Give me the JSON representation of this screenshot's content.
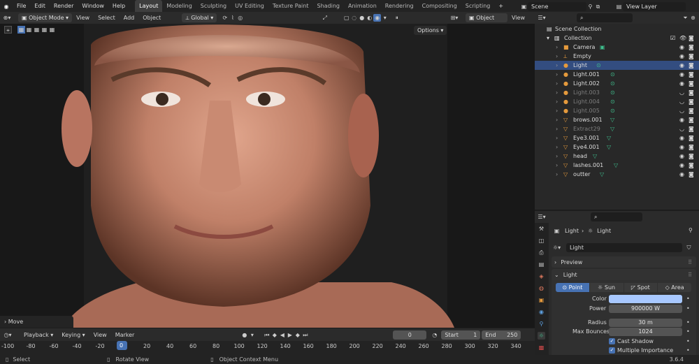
{
  "topbar": {
    "menus": [
      "File",
      "Edit",
      "Render",
      "Window",
      "Help"
    ],
    "workspaces": [
      "Layout",
      "Modeling",
      "Sculpting",
      "UV Editing",
      "Texture Paint",
      "Shading",
      "Animation",
      "Rendering",
      "Compositing",
      "Scripting"
    ],
    "active_workspace": "Layout",
    "scene_label": "Scene",
    "view_layer_label": "View Layer"
  },
  "viewport_header": {
    "mode": "Object Mode",
    "menus": [
      "View",
      "Select",
      "Add",
      "Object"
    ],
    "transform_orientation": "Global",
    "options_label": "Options"
  },
  "viewport": {
    "operator_panel_label": "Move"
  },
  "outliner_header": {
    "display_mode": "Object",
    "view_label": "View"
  },
  "outliner": {
    "scene_collection": "Scene Collection",
    "collection": "Collection",
    "items": [
      {
        "name": "Camera",
        "type": "camera",
        "dim": false,
        "selected": false
      },
      {
        "name": "Empty",
        "type": "empty",
        "dim": false,
        "selected": false
      },
      {
        "name": "Light",
        "type": "light",
        "dim": false,
        "selected": true
      },
      {
        "name": "Light.001",
        "type": "light",
        "dim": false,
        "selected": false
      },
      {
        "name": "Light.002",
        "type": "light",
        "dim": false,
        "selected": false
      },
      {
        "name": "Light.003",
        "type": "light",
        "dim": true,
        "selected": false
      },
      {
        "name": "Light.004",
        "type": "light",
        "dim": true,
        "selected": false
      },
      {
        "name": "Light.005",
        "type": "light",
        "dim": true,
        "selected": false
      },
      {
        "name": "brows.001",
        "type": "mesh",
        "dim": false,
        "selected": false
      },
      {
        "name": "Extract29",
        "type": "mesh",
        "dim": true,
        "selected": false
      },
      {
        "name": "Eye3.001",
        "type": "mesh",
        "dim": false,
        "selected": false
      },
      {
        "name": "Eye4.001",
        "type": "mesh",
        "dim": false,
        "selected": false
      },
      {
        "name": "head",
        "type": "mesh",
        "dim": false,
        "selected": false
      },
      {
        "name": "lashes.001",
        "type": "mesh",
        "dim": false,
        "selected": false
      },
      {
        "name": "outter",
        "type": "mesh",
        "dim": false,
        "selected": false
      }
    ]
  },
  "properties": {
    "breadcrumb_object": "Light",
    "breadcrumb_data": "Light",
    "datablock_name": "Light",
    "preview_label": "Preview",
    "light_panel_label": "Light",
    "light_types": [
      "Point",
      "Sun",
      "Spot",
      "Area"
    ],
    "active_light_type": "Point",
    "color_label": "Color",
    "color_value": "#a8c8ff",
    "power_label": "Power",
    "power_value": "900000 W",
    "radius_label": "Radius",
    "radius_value": "30 m",
    "max_bounces_label": "Max Bounces",
    "max_bounces_value": "1024",
    "cast_shadow_label": "Cast Shadow",
    "multiple_importance_label": "Multiple Importance"
  },
  "timeline": {
    "menus": [
      "Playback",
      "Keying",
      "View",
      "Marker"
    ],
    "current_frame": "0",
    "start_label": "Start",
    "start_value": "1",
    "end_label": "End",
    "end_value": "250",
    "ticks": [
      "-100",
      "-80",
      "-60",
      "-40",
      "-20",
      "0",
      "20",
      "40",
      "60",
      "80",
      "100",
      "120",
      "140",
      "160",
      "180",
      "200",
      "220",
      "240",
      "260",
      "280",
      "300",
      "320",
      "340"
    ]
  },
  "statusbar": {
    "select": "Select",
    "rotate": "Rotate View",
    "context": "Object Context Menu",
    "version": "3.6.4"
  },
  "colors": {
    "accent": "#4772b3",
    "selected_row": "#334d80",
    "light_icon": "#e59a3c",
    "mesh_icon": "#e59a3c",
    "data_icon_green": "#3fbf8e"
  }
}
